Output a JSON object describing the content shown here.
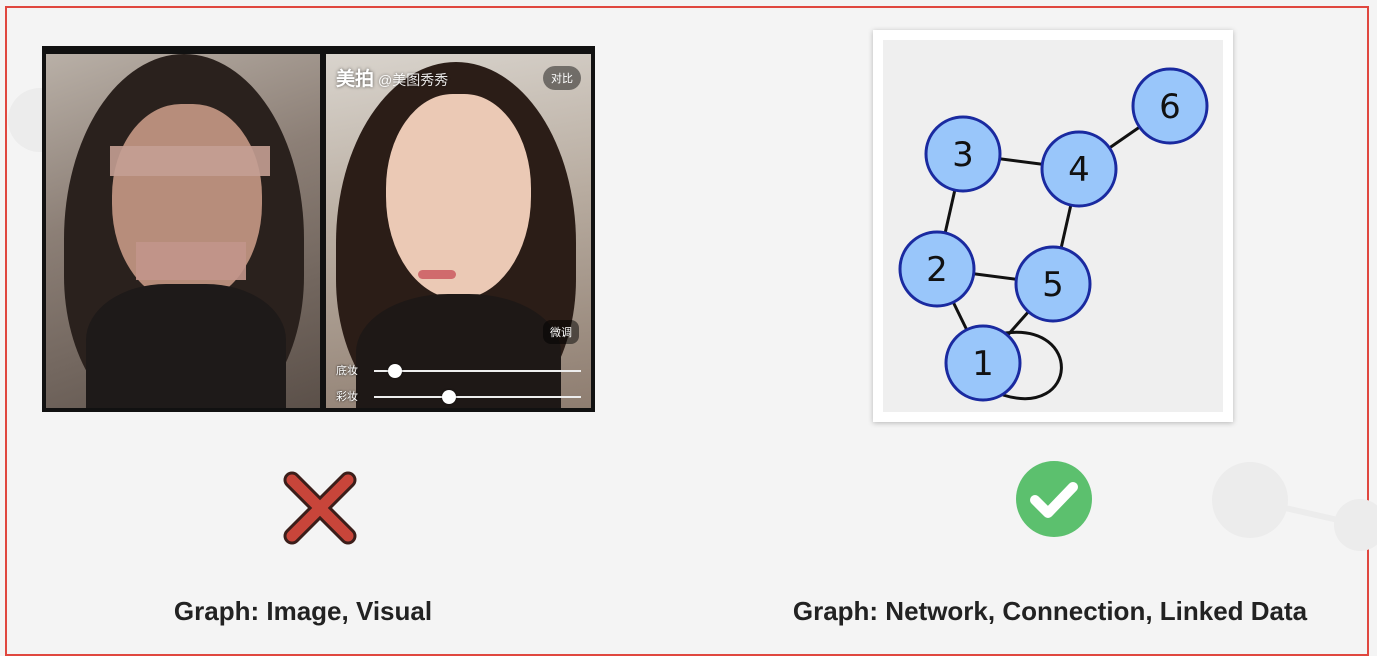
{
  "left_panel": {
    "watermark_logo": "美拍",
    "watermark_tag": "@美图秀秀",
    "compare_button": "对比",
    "fine_tune_button": "微调",
    "slider_foundation": {
      "label": "底妆",
      "level": 0.1
    },
    "slider_color": {
      "label": "彩妆",
      "level": 0.36
    },
    "status_icon": "cross-icon",
    "caption": "Graph: Image, Visual"
  },
  "right_panel": {
    "graph": {
      "nodes": [
        {
          "id": "1",
          "label": "1"
        },
        {
          "id": "2",
          "label": "2"
        },
        {
          "id": "3",
          "label": "3"
        },
        {
          "id": "4",
          "label": "4"
        },
        {
          "id": "5",
          "label": "5"
        },
        {
          "id": "6",
          "label": "6"
        }
      ],
      "edges": [
        [
          "1",
          "2"
        ],
        [
          "1",
          "5"
        ],
        [
          "2",
          "3"
        ],
        [
          "2",
          "5"
        ],
        [
          "3",
          "4"
        ],
        [
          "4",
          "5"
        ],
        [
          "4",
          "6"
        ],
        [
          "1",
          "1"
        ]
      ]
    },
    "status_icon": "check-icon",
    "caption": "Graph: Network, Connection, Linked Data"
  },
  "colors": {
    "frame": "#e0473f",
    "node_fill": "#99c6fa",
    "node_stroke": "#1a2aa0",
    "cross": "#c8453a",
    "check": "#5cc06e"
  }
}
